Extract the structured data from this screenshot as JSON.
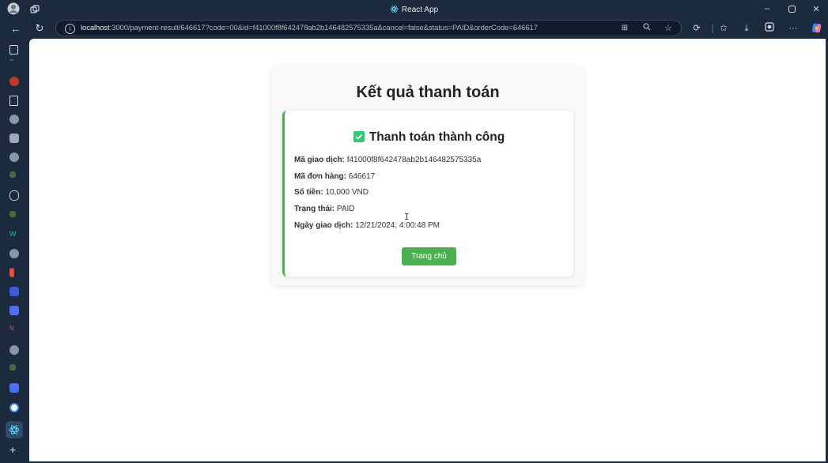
{
  "window": {
    "title": "React App",
    "minimize_icon": "minimize-icon",
    "maximize_icon": "maximize-icon",
    "close_icon": "close-icon"
  },
  "address_bar": {
    "host": "localhost",
    "path": ":3000/payment-result/646617?code=00&id=f41000f8f642478ab2b146482575335a&cancel=false&status=PAID&orderCode=646617"
  },
  "page": {
    "title": "Kết quả thanh toán",
    "status_text": "Thanh toán thành công",
    "details": [
      {
        "label": "Mã giao dịch:",
        "value": "f41000f8f642478ab2b146482575335a"
      },
      {
        "label": "Mã đơn hàng:",
        "value": "646617"
      },
      {
        "label": "Số tiền:",
        "value": "10,000 VND"
      },
      {
        "label": "Trạng thái:",
        "value": "PAID"
      },
      {
        "label": "Ngày giao dịch:",
        "value": "12/21/2024, 4:00:48 PM"
      }
    ],
    "home_button": "Trang chủ"
  },
  "colors": {
    "success_green": "#4caf50",
    "checkbox_green": "#2ecc71",
    "browser_chrome": "#1b2a3d"
  }
}
